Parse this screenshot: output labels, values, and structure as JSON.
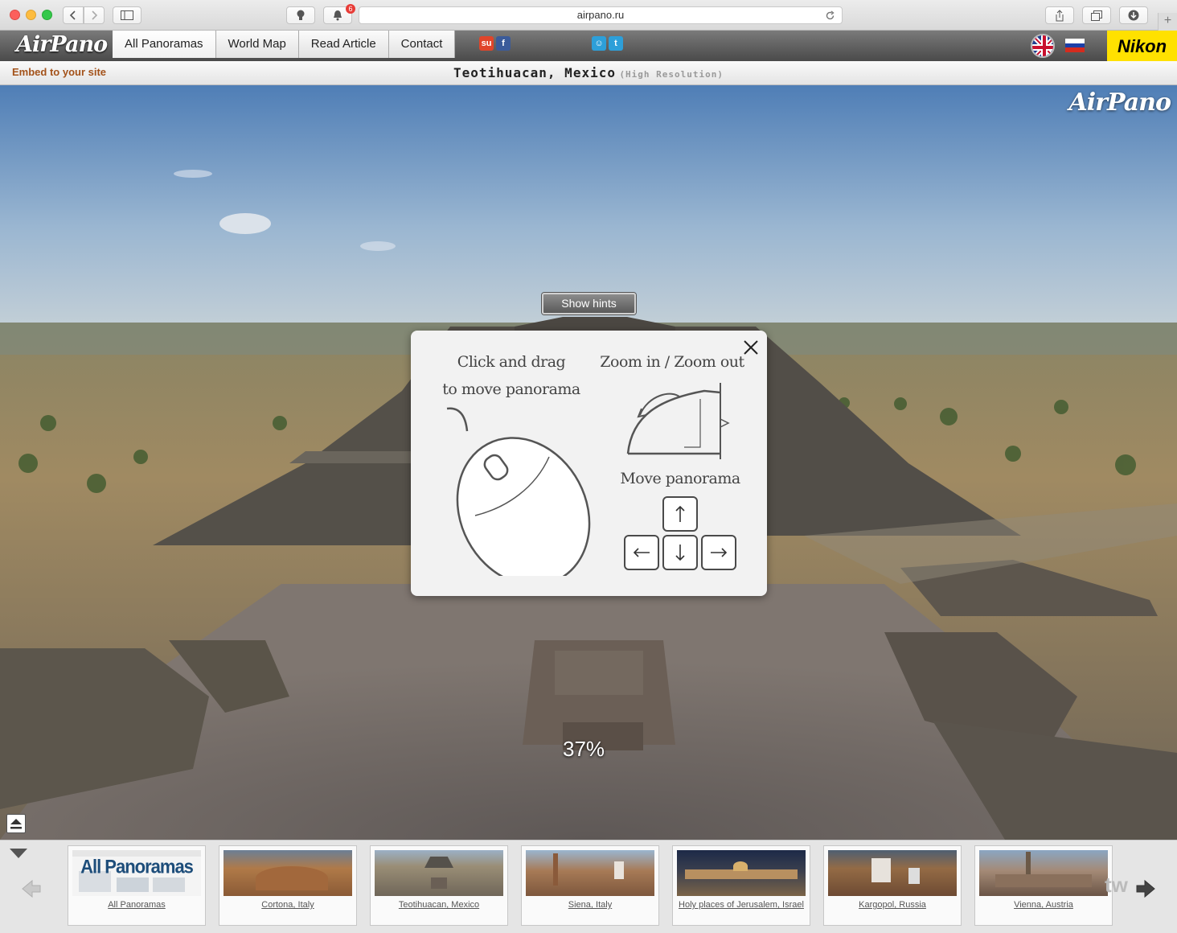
{
  "browser": {
    "url": "airpano.ru",
    "notification_count": "6",
    "new_tab_label": "+"
  },
  "site": {
    "logo": "AirPano",
    "nav": [
      "All Panoramas",
      "World Map",
      "Read Article",
      "Contact"
    ],
    "sponsor": "Nikon"
  },
  "titlebar": {
    "embed_label": "Embed to your site",
    "title": "Teotihuacan, Mexico",
    "subtitle": "(High Resolution)"
  },
  "panorama": {
    "watermark": "AirPano",
    "show_hints_label": "Show hints",
    "loading_progress": "37%"
  },
  "hints": {
    "drag_line1": "Click and drag",
    "drag_line2": "to move panorama",
    "zoom": "Zoom in / Zoom out",
    "move": "Move panorama"
  },
  "thumbnails": [
    {
      "label": "All Panoramas",
      "overlay": "All Panoramas"
    },
    {
      "label": "Cortona, Italy"
    },
    {
      "label": "Teotihuacan, Mexico"
    },
    {
      "label": "Siena, Italy"
    },
    {
      "label": "Holy places of Jerusalem, Israel"
    },
    {
      "label": "Kargopol, Russia"
    },
    {
      "label": "Vienna, Austria"
    }
  ],
  "strip_partial_text": "tw"
}
